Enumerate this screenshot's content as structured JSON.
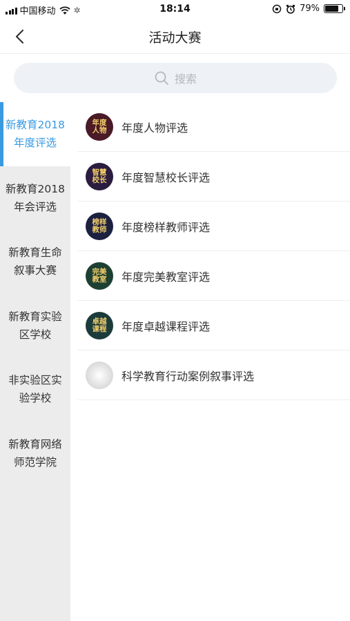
{
  "status_bar": {
    "carrier": "中国移动",
    "time": "18:14",
    "battery_percent": "79%",
    "battery_level": 0.79
  },
  "nav": {
    "title": "活动大赛"
  },
  "search": {
    "placeholder": "搜索"
  },
  "sidebar": {
    "active_index": 0,
    "items": [
      {
        "label": "新教育2018\n年度评选"
      },
      {
        "label": "新教育2018\n年会评选"
      },
      {
        "label": "新教育生命\n叙事大赛"
      },
      {
        "label": "新教育实验\n区学校"
      },
      {
        "label": "非实验区实\n验学校"
      },
      {
        "label": "新教育网络\n师范学院"
      }
    ]
  },
  "list": {
    "items": [
      {
        "label": "年度人物评选",
        "icon_text": [
          "年度",
          "人物"
        ],
        "icon_color": "#4a1a26"
      },
      {
        "label": "年度智慧校长评选",
        "icon_text": [
          "智慧",
          "校长"
        ],
        "icon_color": "#2b1d3f"
      },
      {
        "label": "年度榜样教师评选",
        "icon_text": [
          "榜样",
          "教师"
        ],
        "icon_color": "#1d2140"
      },
      {
        "label": "年度完美教室评选",
        "icon_text": [
          "完美",
          "教室"
        ],
        "icon_color": "#1e4033"
      },
      {
        "label": "年度卓越课程评选",
        "icon_text": [
          "卓越",
          "课程"
        ],
        "icon_color": "#1c3b3b"
      },
      {
        "label": "科学教育行动案例叙事评选",
        "icon_text": [],
        "icon_color": "#d8d8d8"
      }
    ]
  },
  "colors": {
    "accent": "#3a9ae0",
    "sidebar_bg": "#ececec",
    "icon_gold": "#f3cf6c"
  }
}
